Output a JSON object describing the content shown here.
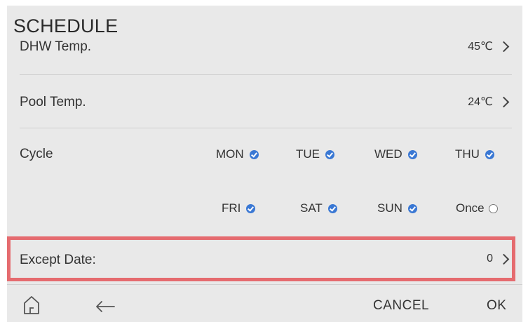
{
  "header": {
    "title": "SCHEDULE"
  },
  "rows": {
    "dhw": {
      "label": "DHW Temp.",
      "value": "45℃"
    },
    "pool": {
      "label": "Pool Temp.",
      "value": "24℃"
    },
    "cycle": {
      "label": "Cycle",
      "days": [
        {
          "label": "MON",
          "checked": true
        },
        {
          "label": "TUE",
          "checked": true
        },
        {
          "label": "WED",
          "checked": true
        },
        {
          "label": "THU",
          "checked": true
        },
        {
          "label": "FRI",
          "checked": true
        },
        {
          "label": "SAT",
          "checked": true
        },
        {
          "label": "SUN",
          "checked": true
        },
        {
          "label": "Once",
          "checked": false
        }
      ]
    },
    "except": {
      "label": "Except Date:",
      "value": "0"
    }
  },
  "footer": {
    "home_icon": "home-icon",
    "back_icon": "back-arrow-icon",
    "cancel_label": "CANCEL",
    "ok_label": "OK"
  },
  "colors": {
    "accent": "#3a78d4",
    "highlight": "#e56b6f",
    "background": "#e9e9e9"
  }
}
